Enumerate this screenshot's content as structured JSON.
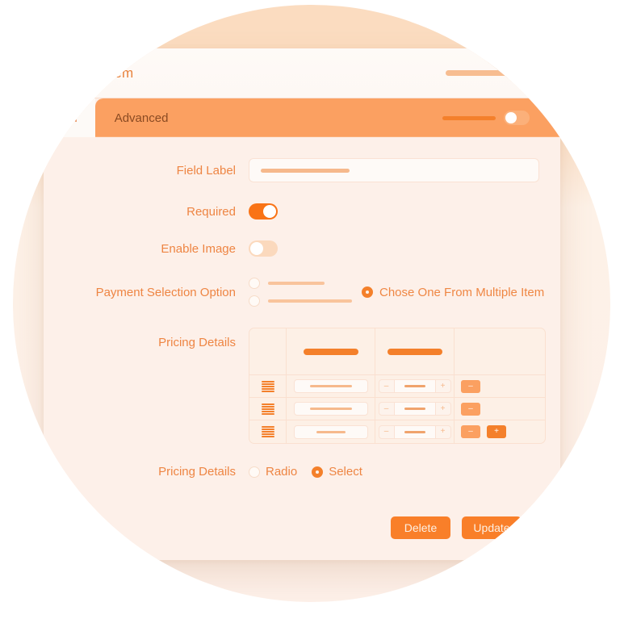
{
  "window": {
    "title": "ment Item",
    "full_title_hint": "Payment Item",
    "chevron_icon": "chevron-down-icon"
  },
  "tabs": [
    {
      "label": "eneral",
      "active": false
    },
    {
      "label": "Advanced",
      "active": true
    }
  ],
  "form": {
    "field_label": {
      "label": "Field Label",
      "value": "",
      "placeholder": ""
    },
    "required": {
      "label": "Required",
      "state": "on"
    },
    "enable_image": {
      "label": "Enable Image",
      "state": "off"
    },
    "payment_selection_option": {
      "label": "Payment Selection Option",
      "selected_option": "Chose One From Multiple Item"
    },
    "pricing_details_table": {
      "label": "Pricing Details"
    },
    "pricing_details_mode": {
      "label": "Pricing Details",
      "options": [
        {
          "label": "Radio",
          "checked": false
        },
        {
          "label": "Select",
          "checked": true
        }
      ]
    }
  },
  "table": {
    "columns": [
      "",
      "",
      "",
      ""
    ],
    "rows": [
      {
        "handle": "drag-handle-icon",
        "name": "",
        "qty": "",
        "actions": [
          "minus"
        ]
      },
      {
        "handle": "drag-handle-icon",
        "name": "",
        "qty": "",
        "actions": [
          "minus"
        ]
      },
      {
        "handle": "drag-handle-icon",
        "name": "",
        "qty": "",
        "actions": [
          "minus",
          "plus"
        ]
      }
    ],
    "stepper": {
      "decrement": "–",
      "increment": "+"
    },
    "action_glyphs": {
      "minus": "–",
      "plus": "+"
    }
  },
  "footer": {
    "delete_label": "Delete",
    "update_label": "Update"
  },
  "colors": {
    "accent": "#f4802b",
    "accent_bright": "#f97316",
    "accent_soft": "#fba061",
    "card_bg": "#fdf0e9",
    "panel_bg": "#fefaf7",
    "label_text": "#ee8543",
    "blob_light": "#fbdcc0",
    "blob_tan": "#ecc6a8"
  }
}
